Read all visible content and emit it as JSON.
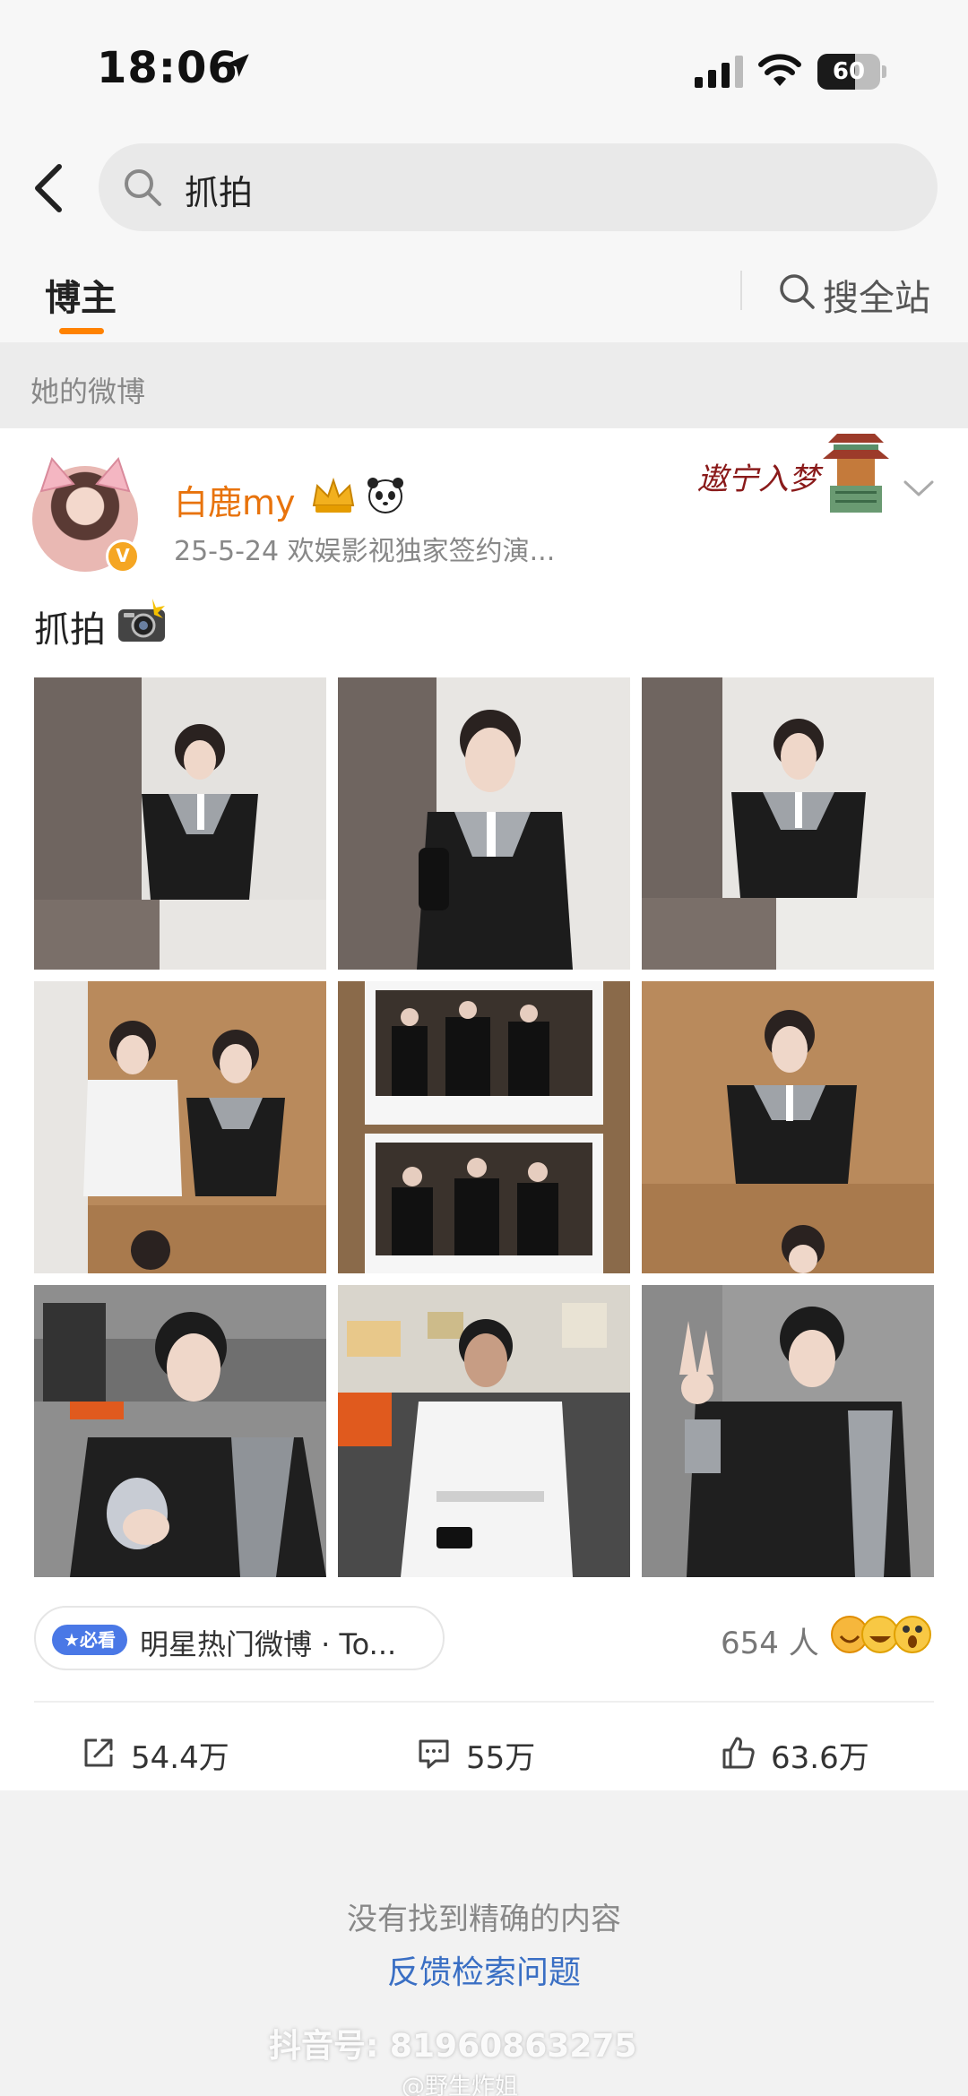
{
  "status_bar": {
    "time": "18:06",
    "battery_level": "60",
    "battery_fraction": 0.6
  },
  "search": {
    "query": "抓拍",
    "icon": "search-icon"
  },
  "tabs": {
    "active": "博主",
    "site_search": "搜全站"
  },
  "section_label": "她的微博",
  "post": {
    "author_name": "白鹿my",
    "meta": "25-5-24  欢娱影视独家签约演...",
    "text": "抓拍",
    "photos": [
      {
        "description": "woman in black jacket against gray wall"
      },
      {
        "description": "woman in black jacket close-up"
      },
      {
        "description": "woman in black jacket leaning"
      },
      {
        "description": "man in white and woman in black"
      },
      {
        "description": "instant photos of group"
      },
      {
        "description": "woman in black jacket wooden wall"
      },
      {
        "description": "man in black holding phone"
      },
      {
        "description": "man in white seated"
      },
      {
        "description": "man making peace sign"
      }
    ],
    "topic_badge": "必看",
    "topic_text": "明星热门微博 · To...",
    "reactions_count": "654 人",
    "actions": {
      "share": "54.4万",
      "comment": "55万",
      "like": "63.6万"
    },
    "brand_colors": {
      "author": "#e8730c",
      "tab_underline": "#ff8200",
      "link": "#3a6fc4"
    }
  },
  "empty_state": {
    "message": "没有找到精确的内容",
    "feedback_link": "反馈检索问题"
  },
  "watermark": {
    "main": "抖音号: 81960863275",
    "sub": "@野生炸姐"
  }
}
